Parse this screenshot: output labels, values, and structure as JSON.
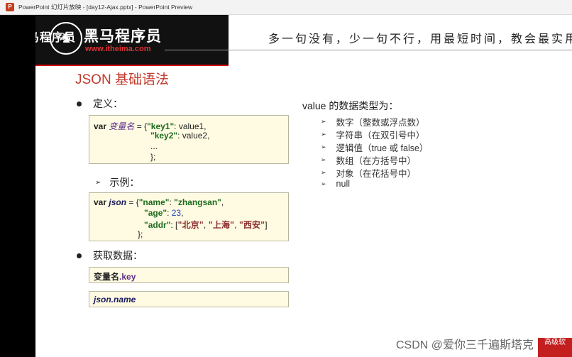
{
  "window": {
    "title": "PowerPoint 幻灯片放映 - [day12-Ajax.pptx] - PowerPoint Preview",
    "app_icon": "powerpoint-icon",
    "app_icon_letter": "P"
  },
  "header": {
    "brand_cn": "黑马程序员",
    "brand_big": "黑马程序员",
    "logo_glyph": "♞",
    "brand_url": "www.itheima.com",
    "slogan": "多一句没有，少一句不行，用最短时间，教会最实用"
  },
  "slide": {
    "heading": "JSON 基础语法",
    "definition": {
      "label": "定义：",
      "code": {
        "var": "var",
        "varname": "变量名",
        "eq_open": " = {",
        "key1": "\"key1\"",
        "val1": ": value1,",
        "key2": "\"key2\"",
        "val2": ": value2,",
        "ellipsis": "...",
        "close": "};"
      }
    },
    "example": {
      "label": "示例：",
      "code": {
        "var": "var",
        "varname": "json",
        "eq_open": " = {",
        "name_key": "\"name\"",
        "colon1": ": ",
        "name_val": "\"zhangsan\"",
        "comma1": ",",
        "age_key": "\"age\"",
        "colon2": ": ",
        "age_val": "23",
        "comma2": ",",
        "addr_key": "\"addr\"",
        "colon3": ": [",
        "addr1": "\"北京\"",
        "sep1": ", ",
        "addr2": "\"上海\"",
        "sep2": ", ",
        "addr3": "\"西安\"",
        "bracket_close": "]",
        "close": "};"
      }
    },
    "get_data": {
      "label": "获取数据：",
      "box1_name": "变量名",
      "box1_key": ".key",
      "box2": "json.name"
    },
    "types": {
      "title": "value 的数据类型为：",
      "items": [
        "数字（整数或浮点数）",
        "字符串（在双引号中）",
        "逻辑值（true 或 false）",
        "数组（在方括号中）",
        "对象（在花括号中）",
        "null"
      ]
    }
  },
  "watermark": "CSDN @爱你三千遍斯塔克",
  "corner_badge": "高级软"
}
